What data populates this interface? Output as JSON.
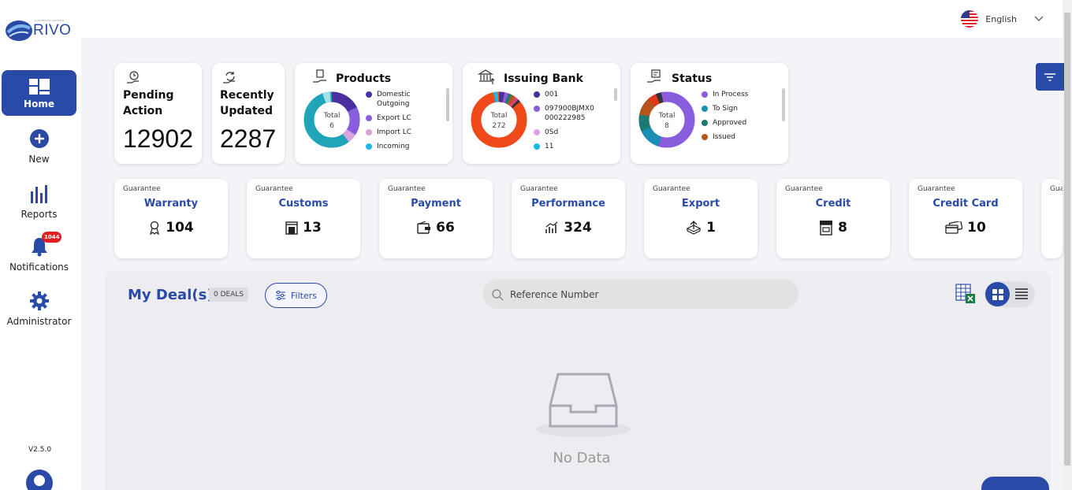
{
  "app": {
    "logo_text": "RIVO",
    "logo_tagline": "A SILVERLAKE SOLUTION",
    "version": "V2.5.0"
  },
  "sidebar": {
    "items": [
      {
        "label": "Home",
        "icon": "home-grid-icon",
        "active": true
      },
      {
        "label": "New",
        "icon": "plus-circle-icon"
      },
      {
        "label": "Reports",
        "icon": "bar-chart-icon"
      },
      {
        "label": "Notifications",
        "icon": "bell-icon",
        "badge": "1044"
      },
      {
        "label": "Administrator",
        "icon": "gear-icon"
      }
    ]
  },
  "header": {
    "language": "English",
    "language_icon": "us-flag-icon"
  },
  "summary": {
    "pending": {
      "title_line1": "Pending",
      "title_line2": "Action",
      "value": "12902"
    },
    "recent": {
      "title_line1": "Recently",
      "title_line2": "Updated",
      "value": "2287"
    }
  },
  "charts": [
    {
      "title": "Products",
      "total_label": "Total",
      "total": "6",
      "legend": [
        {
          "label": "Domestic Outgoing",
          "color": "#4b2f9e"
        },
        {
          "label": "Export LC",
          "color": "#8a5cde"
        },
        {
          "label": "Import LC",
          "color": "#d9a3e0"
        },
        {
          "label": "Incoming",
          "color": "#1fb5e8"
        }
      ]
    },
    {
      "title": "Issuing Bank",
      "total_label": "Total",
      "total": "272",
      "legend": [
        {
          "label": "001",
          "color": "#4b2f9e"
        },
        {
          "label": "097900BJMX0000222985",
          "color": "#8a5cde"
        },
        {
          "label": "0Sd",
          "color": "#d9a3e0"
        },
        {
          "label": "11",
          "color": "#1fb5e8"
        }
      ]
    },
    {
      "title": "Status",
      "total_label": "Total",
      "total": "8",
      "legend": [
        {
          "label": "In Process",
          "color": "#8a5cde"
        },
        {
          "label": "To Sign",
          "color": "#1a8fb5"
        },
        {
          "label": "Approved",
          "color": "#1b7a72"
        },
        {
          "label": "Issued",
          "color": "#b4561a"
        }
      ]
    }
  ],
  "guarantees": [
    {
      "label": "Guarantee",
      "name": "Warranty",
      "value": "104",
      "icon": "ribbon-icon"
    },
    {
      "label": "Guarantee",
      "name": "Customs",
      "value": "13",
      "icon": "customs-gate-icon"
    },
    {
      "label": "Guarantee",
      "name": "Payment",
      "value": "66",
      "icon": "wallet-icon"
    },
    {
      "label": "Guarantee",
      "name": "Performance",
      "value": "324",
      "icon": "performance-chart-icon"
    },
    {
      "label": "Guarantee",
      "name": "Export",
      "value": "1",
      "icon": "export-box-icon"
    },
    {
      "label": "Guarantee",
      "name": "Credit",
      "value": "8",
      "icon": "store-icon"
    },
    {
      "label": "Guarantee",
      "name": "Credit Card",
      "value": "10",
      "icon": "credit-card-icon"
    },
    {
      "label": "Gua",
      "name": "",
      "value": "",
      "icon": ""
    }
  ],
  "deals": {
    "title": "My Deal(s)",
    "count": "0 DEALS",
    "filters_label": "Filters",
    "search_placeholder": "Reference Number",
    "empty_text": "No Data"
  }
}
